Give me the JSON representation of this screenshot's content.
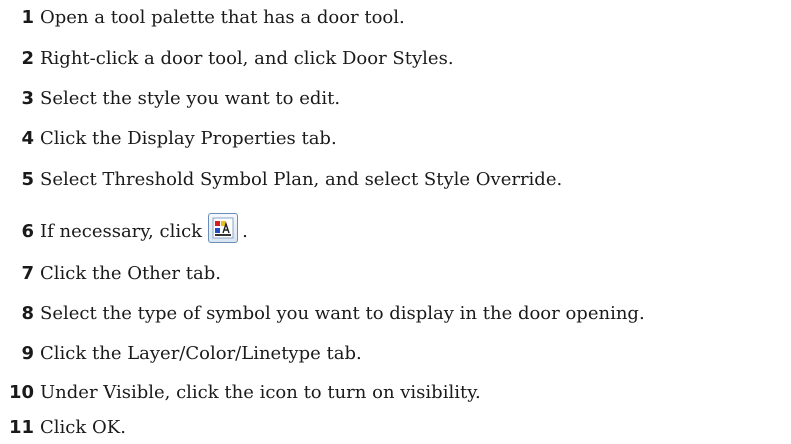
{
  "steps": [
    {
      "num": "1",
      "text": "Open a tool palette that has a door tool."
    },
    {
      "num": "2",
      "text": "Right-click a door tool, and click Door Styles."
    },
    {
      "num": "3",
      "text": "Select the style you want to edit."
    },
    {
      "num": "4",
      "text": "Click the Display Properties tab."
    },
    {
      "num": "5",
      "text": "Select Threshold Symbol Plan, and select Style Override."
    },
    {
      "num": "6",
      "text": "If necessary, click",
      "after_icon": ".",
      "icon": "display-properties-icon"
    },
    {
      "num": "7",
      "text": "Click the Other tab."
    },
    {
      "num": "8",
      "text": "Select the type of symbol you want to display in the door opening."
    },
    {
      "num": "9",
      "text": "Click the Layer/Color/Linetype tab."
    },
    {
      "num": "10",
      "text": "Under Visible, click the icon to turn on visibility."
    },
    {
      "num": "11",
      "text": "Click OK."
    }
  ],
  "colors": {
    "text": "#1a1a1a",
    "icon_border": "#6a8fb6",
    "icon_red": "#d42020",
    "icon_yellow": "#e8c020",
    "icon_blue": "#2050c8"
  }
}
